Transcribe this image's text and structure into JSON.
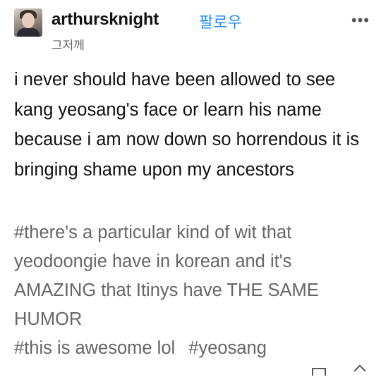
{
  "post": {
    "username": "arthursknight",
    "follow_label": "팔로우",
    "timestamp": "그저께",
    "more_label": "•••",
    "body": "i never should have been allowed to see kang yeosang's face or learn his name because i am now down so horrendous it is bringing shame upon my ancestors",
    "tags": [
      "#there's a particular kind of wit that yeodoongie have in korean and it's AMAZING that Itinys have THE SAME HUMOR",
      "#this is awesome lol",
      "#yeosang"
    ]
  },
  "icons": {
    "avatar": "user-avatar",
    "more": "more-options-icon",
    "footer_left": "notes-icon",
    "footer_right": "edit-icon"
  }
}
